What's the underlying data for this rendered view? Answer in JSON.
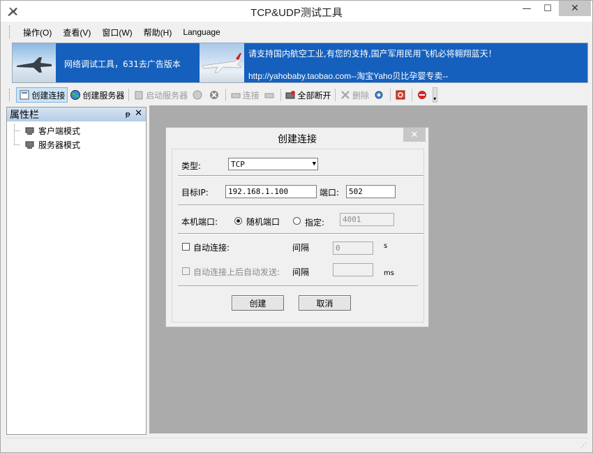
{
  "window": {
    "title": "TCP&UDP测试工具",
    "min": "—",
    "max": "☐",
    "close": "✕"
  },
  "menu": [
    "操作(O)",
    "查看(V)",
    "窗口(W)",
    "帮助(H)",
    "Language"
  ],
  "banner": {
    "text1": "网络调试工具，631去广告版本",
    "text2": "请支持国内航空工业,有您的支持,国产军用民用飞机必将翱翔蓝天！",
    "text3": "http://yahobaby.taobao.com--淘宝Yaho贝比孕婴专卖--"
  },
  "toolbar": {
    "create_connection": "创建连接",
    "create_server": "创建服务器",
    "start_server": "启动服务器",
    "connect": "连接",
    "disconnect_all": "全部断开",
    "delete": "删除"
  },
  "panel": {
    "title": "属性栏",
    "pin": "ᵽ",
    "close": "✕",
    "items": [
      "客户端模式",
      "服务器模式"
    ]
  },
  "dialog": {
    "title": "创建连接",
    "close": "✕",
    "type_label": "类型:",
    "type_value": "TCP",
    "target_ip_label": "目标IP:",
    "target_ip_value": "192.168.1.100",
    "port_label": "端口:",
    "port_value": "502",
    "local_port_label": "本机端口:",
    "random_port_label": "随机端口",
    "specify_label": "指定:",
    "specify_value": "4001",
    "auto_connect_label": "自动连接:",
    "interval_label": "间隔",
    "interval_value": "0",
    "unit_s": "s",
    "auto_send_label": "自动连接上后自动发送:",
    "interval2_label": "间隔",
    "interval2_value": "",
    "unit_ms": "ms",
    "ok_label": "创建",
    "cancel_label": "取消",
    "random_port_checked": true,
    "auto_connect_checked": false
  },
  "colors": {
    "banner_bg": "#1560bd",
    "mdi_bg": "#ababab",
    "panel_header": "#c5d9ee"
  }
}
